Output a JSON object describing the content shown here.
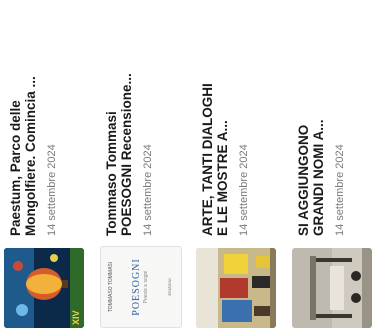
{
  "articles": [
    {
      "title_line1": "Paestum, Parco delle",
      "title_line2": "Mongolfiere. Comincia ...",
      "date": "14 settembre 2024",
      "thumb_badge": "XIV"
    },
    {
      "title_line1": "Tommaso Tommasi",
      "title_line2": "POESOGNI Recensione...",
      "date": "14 settembre 2024",
      "thumb_author": "TOMMASO TOMMASI",
      "thumb_title": "POESOGNI",
      "thumb_subtitle": "Poesie e sogni",
      "thumb_publisher": "EDIZIONI"
    },
    {
      "title_line1": "ARTE, TANTI DIALOGHI",
      "title_line2": "E LE MOSTRE A...",
      "date": "14 settembre 2024"
    },
    {
      "title_line1": "SI AGGIUNGONO",
      "title_line2": "GRANDI NOMI A...",
      "date": "14 settembre 2024"
    }
  ]
}
